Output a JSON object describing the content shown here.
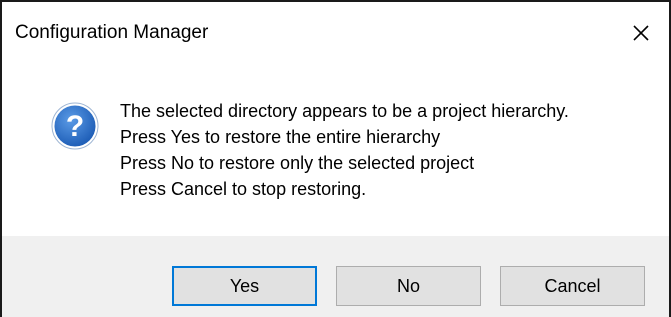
{
  "window": {
    "title": "Configuration Manager",
    "close_icon": "close-icon"
  },
  "message": {
    "icon": "question-icon",
    "icon_colors": {
      "fill": "#1f5fb8",
      "ring": "#ffffff",
      "glyph": "#ffffff"
    },
    "lines": [
      "The selected directory appears to be a project hierarchy.",
      "Press Yes to restore the entire hierarchy",
      "Press No to restore only the selected project",
      "Press Cancel to stop restoring."
    ]
  },
  "buttons": {
    "yes_label": "Yes",
    "no_label": "No",
    "cancel_label": "Cancel"
  },
  "colors": {
    "footer_bg": "#f0f0f0",
    "button_bg": "#e1e1e1",
    "focus_border": "#0078d7"
  }
}
